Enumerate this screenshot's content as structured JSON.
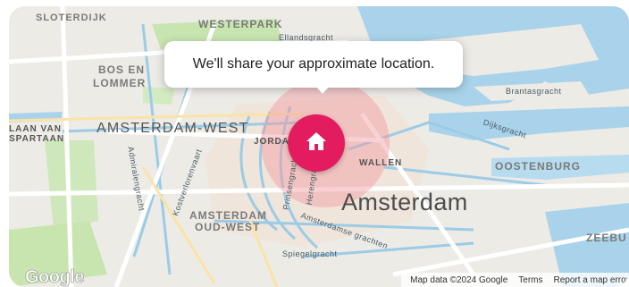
{
  "map": {
    "tooltip": "We'll share your approximate location.",
    "labels": {
      "sloterdijk": "SLOTERDIJK",
      "westerpark": "WESTERPARK",
      "ellandsgracht": "Ellandsgracht",
      "bos_en": "BOS EN",
      "lommer": "LOMMER",
      "laan_van": "LAAN VAN",
      "spartaan": "SPARTAAN",
      "amsterdam_west": "AMSTERDAM-WEST",
      "jordaan": "JORDAAN",
      "wallen": "WALLEN",
      "brantasgracht": "Brantasgracht",
      "dijksgracht": "Dijksgracht",
      "oostenburg": "OOSTENBURG",
      "admiralengracht": "Admiralengracht",
      "kostverlorenvaart": "Kostverlorenvaart",
      "prinsengracht": "Prinsengracht",
      "herengracht": "Herengracht",
      "amsterdam_oud_1": "AMSTERDAM",
      "amsterdam_oud_2": "OUD-WEST",
      "amsterdamse_grachten": "Amsterdamse grachten",
      "spiegelgracht": "Spiegelgracht",
      "city": "Amsterdam",
      "zeebu": "ZEEBU"
    },
    "logo": "Google",
    "attribution": {
      "data": "Map data ©2024 Google",
      "terms": "Terms",
      "report": "Report a map error"
    },
    "pin_icon": "home-icon",
    "colors": {
      "pin": "#e31c5f",
      "radius": "#f4a6a8",
      "water": "#a9d3ea",
      "park": "#c8e5b0"
    }
  }
}
